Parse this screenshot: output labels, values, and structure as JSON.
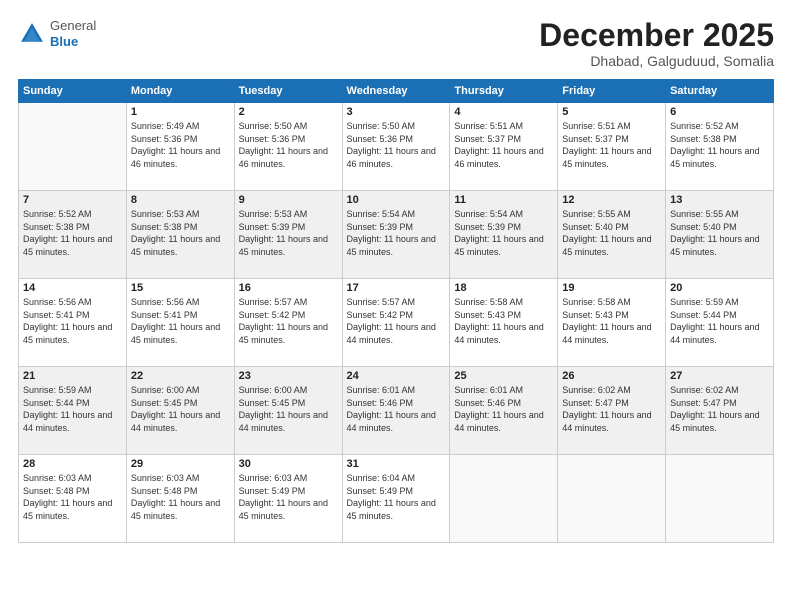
{
  "header": {
    "logo_general": "General",
    "logo_blue": "Blue",
    "month_title": "December 2025",
    "subtitle": "Dhabad, Galguduud, Somalia"
  },
  "calendar": {
    "days_of_week": [
      "Sunday",
      "Monday",
      "Tuesday",
      "Wednesday",
      "Thursday",
      "Friday",
      "Saturday"
    ],
    "weeks": [
      [
        {
          "day": "",
          "info": ""
        },
        {
          "day": "1",
          "info": "Sunrise: 5:49 AM\nSunset: 5:36 PM\nDaylight: 11 hours\nand 46 minutes."
        },
        {
          "day": "2",
          "info": "Sunrise: 5:50 AM\nSunset: 5:36 PM\nDaylight: 11 hours\nand 46 minutes."
        },
        {
          "day": "3",
          "info": "Sunrise: 5:50 AM\nSunset: 5:36 PM\nDaylight: 11 hours\nand 46 minutes."
        },
        {
          "day": "4",
          "info": "Sunrise: 5:51 AM\nSunset: 5:37 PM\nDaylight: 11 hours\nand 46 minutes."
        },
        {
          "day": "5",
          "info": "Sunrise: 5:51 AM\nSunset: 5:37 PM\nDaylight: 11 hours\nand 45 minutes."
        },
        {
          "day": "6",
          "info": "Sunrise: 5:52 AM\nSunset: 5:38 PM\nDaylight: 11 hours\nand 45 minutes."
        }
      ],
      [
        {
          "day": "7",
          "info": "Sunrise: 5:52 AM\nSunset: 5:38 PM\nDaylight: 11 hours\nand 45 minutes."
        },
        {
          "day": "8",
          "info": "Sunrise: 5:53 AM\nSunset: 5:38 PM\nDaylight: 11 hours\nand 45 minutes."
        },
        {
          "day": "9",
          "info": "Sunrise: 5:53 AM\nSunset: 5:39 PM\nDaylight: 11 hours\nand 45 minutes."
        },
        {
          "day": "10",
          "info": "Sunrise: 5:54 AM\nSunset: 5:39 PM\nDaylight: 11 hours\nand 45 minutes."
        },
        {
          "day": "11",
          "info": "Sunrise: 5:54 AM\nSunset: 5:39 PM\nDaylight: 11 hours\nand 45 minutes."
        },
        {
          "day": "12",
          "info": "Sunrise: 5:55 AM\nSunset: 5:40 PM\nDaylight: 11 hours\nand 45 minutes."
        },
        {
          "day": "13",
          "info": "Sunrise: 5:55 AM\nSunset: 5:40 PM\nDaylight: 11 hours\nand 45 minutes."
        }
      ],
      [
        {
          "day": "14",
          "info": "Sunrise: 5:56 AM\nSunset: 5:41 PM\nDaylight: 11 hours\nand 45 minutes."
        },
        {
          "day": "15",
          "info": "Sunrise: 5:56 AM\nSunset: 5:41 PM\nDaylight: 11 hours\nand 45 minutes."
        },
        {
          "day": "16",
          "info": "Sunrise: 5:57 AM\nSunset: 5:42 PM\nDaylight: 11 hours\nand 45 minutes."
        },
        {
          "day": "17",
          "info": "Sunrise: 5:57 AM\nSunset: 5:42 PM\nDaylight: 11 hours\nand 44 minutes."
        },
        {
          "day": "18",
          "info": "Sunrise: 5:58 AM\nSunset: 5:43 PM\nDaylight: 11 hours\nand 44 minutes."
        },
        {
          "day": "19",
          "info": "Sunrise: 5:58 AM\nSunset: 5:43 PM\nDaylight: 11 hours\nand 44 minutes."
        },
        {
          "day": "20",
          "info": "Sunrise: 5:59 AM\nSunset: 5:44 PM\nDaylight: 11 hours\nand 44 minutes."
        }
      ],
      [
        {
          "day": "21",
          "info": "Sunrise: 5:59 AM\nSunset: 5:44 PM\nDaylight: 11 hours\nand 44 minutes."
        },
        {
          "day": "22",
          "info": "Sunrise: 6:00 AM\nSunset: 5:45 PM\nDaylight: 11 hours\nand 44 minutes."
        },
        {
          "day": "23",
          "info": "Sunrise: 6:00 AM\nSunset: 5:45 PM\nDaylight: 11 hours\nand 44 minutes."
        },
        {
          "day": "24",
          "info": "Sunrise: 6:01 AM\nSunset: 5:46 PM\nDaylight: 11 hours\nand 44 minutes."
        },
        {
          "day": "25",
          "info": "Sunrise: 6:01 AM\nSunset: 5:46 PM\nDaylight: 11 hours\nand 44 minutes."
        },
        {
          "day": "26",
          "info": "Sunrise: 6:02 AM\nSunset: 5:47 PM\nDaylight: 11 hours\nand 44 minutes."
        },
        {
          "day": "27",
          "info": "Sunrise: 6:02 AM\nSunset: 5:47 PM\nDaylight: 11 hours\nand 45 minutes."
        }
      ],
      [
        {
          "day": "28",
          "info": "Sunrise: 6:03 AM\nSunset: 5:48 PM\nDaylight: 11 hours\nand 45 minutes."
        },
        {
          "day": "29",
          "info": "Sunrise: 6:03 AM\nSunset: 5:48 PM\nDaylight: 11 hours\nand 45 minutes."
        },
        {
          "day": "30",
          "info": "Sunrise: 6:03 AM\nSunset: 5:49 PM\nDaylight: 11 hours\nand 45 minutes."
        },
        {
          "day": "31",
          "info": "Sunrise: 6:04 AM\nSunset: 5:49 PM\nDaylight: 11 hours\nand 45 minutes."
        },
        {
          "day": "",
          "info": ""
        },
        {
          "day": "",
          "info": ""
        },
        {
          "day": "",
          "info": ""
        }
      ]
    ]
  }
}
